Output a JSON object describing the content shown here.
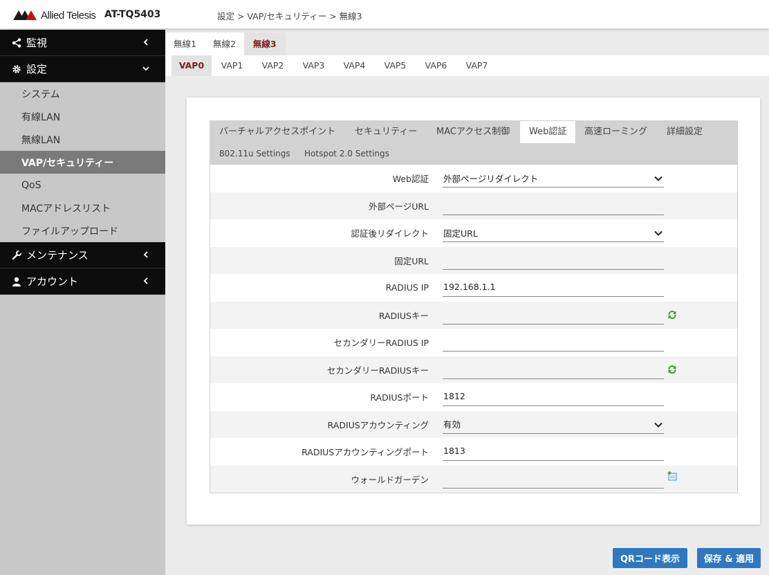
{
  "header": {
    "logo_text": "Allied Telesis",
    "model": "AT-TQ5403",
    "breadcrumb": "設定 > VAP/セキュリティー > 無線3"
  },
  "sidebar": {
    "groups": {
      "monitor": "監視",
      "settings": "設定",
      "maintenance": "メンテナンス",
      "account": "アカウント"
    },
    "items": [
      "システム",
      "有線LAN",
      "無線LAN",
      "VAP/セキュリティー",
      "QoS",
      "MACアドレスリスト",
      "ファイルアップロード"
    ]
  },
  "radio_tabs": [
    "無線1",
    "無線2",
    "無線3"
  ],
  "vap_tabs": [
    "VAP0",
    "VAP1",
    "VAP2",
    "VAP3",
    "VAP4",
    "VAP5",
    "VAP6",
    "VAP7"
  ],
  "sub_tabs": [
    "バーチャルアクセスポイント",
    "セキュリティー",
    "MACアクセス制御",
    "Web認証",
    "高速ローミング",
    "詳細設定",
    "802.11u Settings",
    "Hotspot 2.0 Settings"
  ],
  "form": {
    "web_auth": {
      "label": "Web認証",
      "value": "外部ページリダイレクト"
    },
    "external_url": {
      "label": "外部ページURL",
      "value": ""
    },
    "post_redirect": {
      "label": "認証後リダイレクト",
      "value": "固定URL"
    },
    "fixed_url": {
      "label": "固定URL",
      "value": ""
    },
    "radius_ip": {
      "label": "RADIUS IP",
      "value": "192.168.1.1"
    },
    "radius_key": {
      "label": "RADIUSキー",
      "value": ""
    },
    "secondary_radius_ip": {
      "label": "セカンダリーRADIUS IP",
      "value": ""
    },
    "secondary_radius_key": {
      "label": "セカンダリーRADIUSキー",
      "value": ""
    },
    "radius_port": {
      "label": "RADIUSポート",
      "value": "1812"
    },
    "radius_accounting": {
      "label": "RADIUSアカウンティング",
      "value": "有効"
    },
    "radius_accounting_port": {
      "label": "RADIUSアカウンティングポート",
      "value": "1813"
    },
    "walled_garden": {
      "label": "ウォールドガーデン",
      "value": ""
    }
  },
  "buttons": {
    "qr": "QRコード表示",
    "save": "保存 & 適用"
  },
  "colors": {
    "accent_tab": "#7c1e1e",
    "button": "#2f78c1",
    "sidebar_dark": "#0d0d0d",
    "sidebar_active": "#7a7a7a",
    "refresh_icon": "#3a9a2a"
  }
}
